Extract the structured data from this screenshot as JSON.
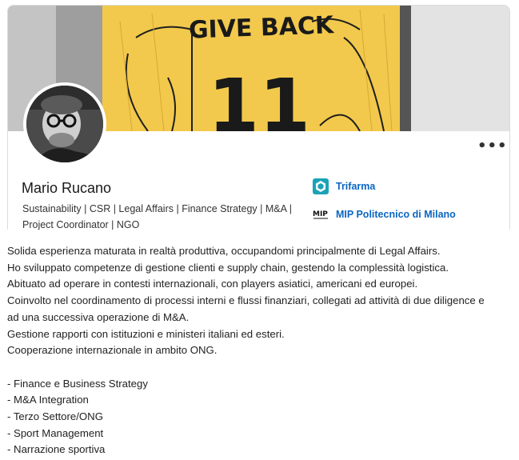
{
  "cover": {
    "banner_text": "GIVE BACK",
    "banner_number": "11",
    "accent_color": "#f2c94c"
  },
  "profile": {
    "name": "Mario Rucano",
    "headline_line1": "Sustainability | CSR | Legal Affairs | Finance Strategy | M&A |",
    "headline_line2": "Project Coordinator | NGO"
  },
  "menu": {
    "more_label": "•••"
  },
  "experience": [
    {
      "name": "Trifarma",
      "icon": "trifarma-logo"
    },
    {
      "name": "MIP Politecnico di Milano",
      "icon": "mip-logo",
      "logo_text": "MIP"
    }
  ],
  "about": {
    "lines": [
      "Solida esperienza maturata in realtà produttiva, occupandomi principalmente di Legal Affairs.",
      "Ho sviluppato competenze di gestione clienti e supply chain, gestendo la complessità logistica.",
      "Abituato ad operare in contesti internazionali, con players asiatici, americani ed europei.",
      "Coinvolto nel coordinamento di processi interni e flussi finanziari, collegati ad attività di due diligence e",
      "ad una successiva operazione di M&A.",
      "Gestione rapporti con istituzioni e ministeri italiani ed esteri.",
      "Cooperazione internazionale in ambito ONG.",
      "",
      "- Finance e Business Strategy",
      "- M&A Integration",
      "- Terzo Settore/ONG",
      "- Sport Management",
      "- Narrazione sportiva"
    ]
  }
}
